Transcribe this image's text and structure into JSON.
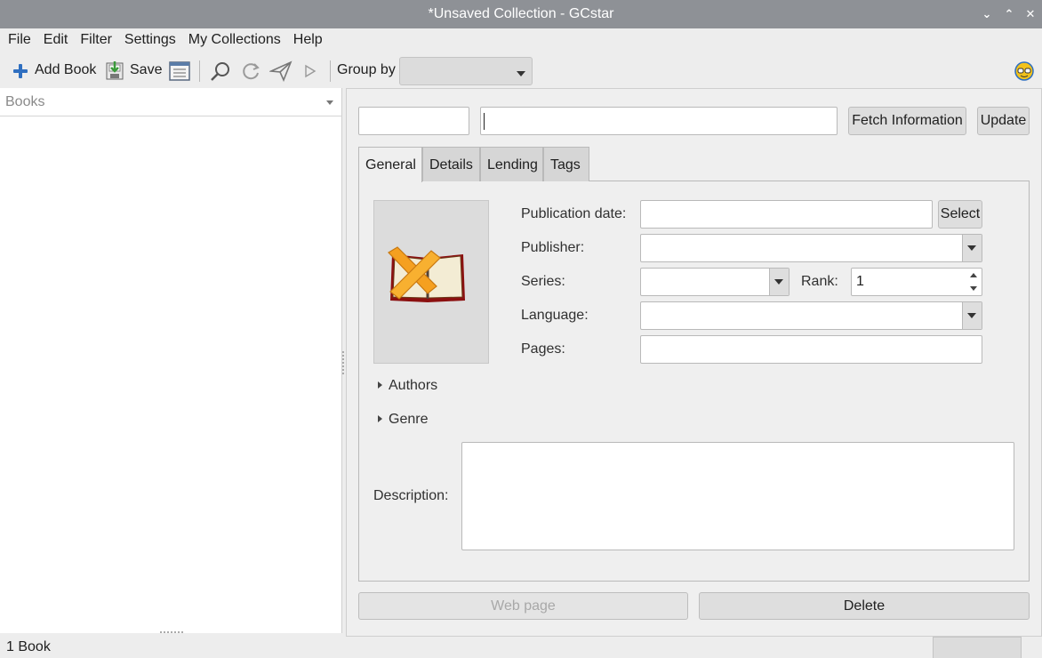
{
  "window": {
    "title": "*Unsaved Collection - GCstar"
  },
  "menu": {
    "items": [
      "File",
      "Edit",
      "Filter",
      "Settings",
      "My Collections",
      "Help"
    ]
  },
  "toolbar": {
    "add_book_label": "Add Book",
    "save_label": "Save",
    "group_by_label": "Group by",
    "group_by_value": ""
  },
  "left_panel": {
    "header": "Books"
  },
  "search": {
    "value": "",
    "title_value": ""
  },
  "actions": {
    "fetch_label": "Fetch Information",
    "update_label": "Update"
  },
  "tabs": [
    {
      "label": "General",
      "active": true
    },
    {
      "label": "Details",
      "active": false
    },
    {
      "label": "Lending",
      "active": false
    },
    {
      "label": "Tags",
      "active": false
    }
  ],
  "form": {
    "publication_date_label": "Publication date:",
    "publication_date_value": "",
    "select_label": "Select",
    "publisher_label": "Publisher:",
    "publisher_value": "",
    "series_label": "Series:",
    "series_value": "",
    "rank_label": "Rank:",
    "rank_value": "1",
    "language_label": "Language:",
    "language_value": "",
    "pages_label": "Pages:",
    "pages_value": "",
    "authors_label": "Authors",
    "genre_label": "Genre",
    "description_label": "Description:",
    "description_value": ""
  },
  "bottom": {
    "web_page_label": "Web page",
    "delete_label": "Delete"
  },
  "status": {
    "text": "1 Book"
  },
  "colors": {
    "titlebar": "#8e9196",
    "accent_blue": "#2f6fc0"
  },
  "icons": [
    "plus-icon",
    "save-icon",
    "list-view-icon",
    "search-icon",
    "refresh-icon",
    "send-icon",
    "play-icon",
    "gcstar-logo-icon",
    "no-cover-book-icon"
  ]
}
